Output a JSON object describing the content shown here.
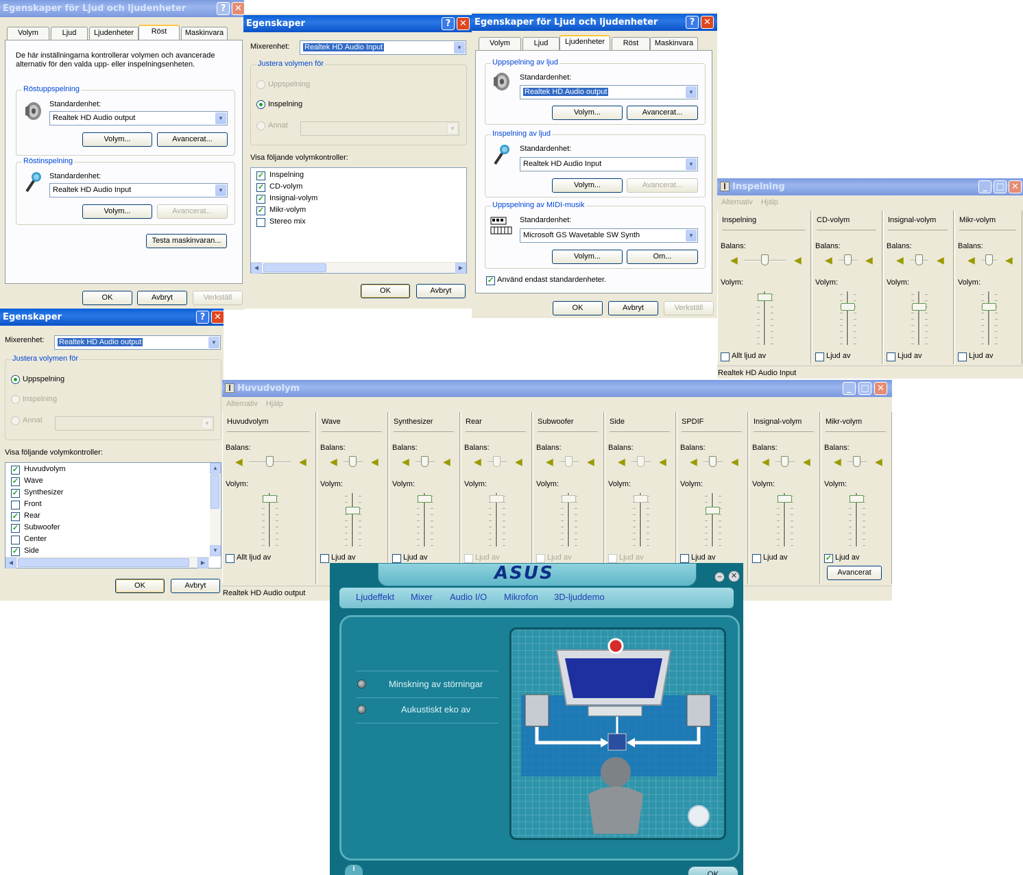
{
  "win1": {
    "title": "Egenskaper för Ljud och ljudenheter",
    "tabs": [
      "Volym",
      "Ljud",
      "Ljudenheter",
      "Röst",
      "Maskinvara"
    ],
    "description": "De här inställningarna kontrollerar volymen och avancerade alternativ för den valda upp- eller inspelningsenheten.",
    "playback_group": "Röstuppspelning",
    "recording_group": "Röstinspelning",
    "default_device_label": "Standardenhet:",
    "playback_device": "Realtek HD Audio output",
    "recording_device": "Realtek HD Audio Input",
    "volume_btn": "Volym...",
    "advanced_btn": "Avancerat...",
    "test_btn": "Testa maskinvaran...",
    "ok": "OK",
    "cancel": "Avbryt",
    "apply": "Verkställ"
  },
  "win2": {
    "title": "Egenskaper",
    "mixer_label": "Mixerenhet:",
    "mixer_value": "Realtek HD Audio Input",
    "adjust_group": "Justera volymen för",
    "radio_playback": "Uppspelning",
    "radio_recording": "Inspelning",
    "radio_other": "Annat",
    "show_label": "Visa följande volymkontroller:",
    "controls": [
      {
        "label": "Inspelning",
        "checked": true
      },
      {
        "label": "CD-volym",
        "checked": true
      },
      {
        "label": "Insignal-volym",
        "checked": true
      },
      {
        "label": "Mikr-volym",
        "checked": true
      },
      {
        "label": "Stereo mix",
        "checked": false
      }
    ],
    "ok": "OK",
    "cancel": "Avbryt"
  },
  "win3": {
    "title": "Egenskaper för Ljud och ljudenheter",
    "tabs": [
      "Volym",
      "Ljud",
      "Ljudenheter",
      "Röst",
      "Maskinvara"
    ],
    "playback_group": "Uppspelning av ljud",
    "recording_group": "Inspelning av ljud",
    "midi_group": "Uppspelning av MIDI-musik",
    "default_device_label": "Standardenhet:",
    "playback_device": "Realtek HD Audio output",
    "recording_device": "Realtek HD Audio Input",
    "midi_device": "Microsoft GS Wavetable SW Synth",
    "volume_btn": "Volym...",
    "advanced_btn": "Avancerat...",
    "about_btn": "Om...",
    "only_default": "Använd endast standardenheter.",
    "ok": "OK",
    "cancel": "Avbryt",
    "apply": "Verkställ"
  },
  "win4": {
    "title": "Egenskaper",
    "mixer_label": "Mixerenhet:",
    "mixer_value": "Realtek HD Audio output",
    "adjust_group": "Justera volymen för",
    "radio_playback": "Uppspelning",
    "radio_recording": "Inspelning",
    "radio_other": "Annat",
    "show_label": "Visa följande volymkontroller:",
    "controls": [
      {
        "label": "Huvudvolym",
        "checked": true
      },
      {
        "label": "Wave",
        "checked": true
      },
      {
        "label": "Synthesizer",
        "checked": true
      },
      {
        "label": "Front",
        "checked": false
      },
      {
        "label": "Rear",
        "checked": true
      },
      {
        "label": "Subwoofer",
        "checked": true
      },
      {
        "label": "Center",
        "checked": false
      },
      {
        "label": "Side",
        "checked": true
      }
    ],
    "ok": "OK",
    "cancel": "Avbryt"
  },
  "rec_mixer": {
    "title": "Inspelning",
    "menu": [
      "Alternativ",
      "Hjälp"
    ],
    "balance_label": "Balans:",
    "volume_label": "Volym:",
    "status": "Realtek HD Audio Input",
    "channels": [
      {
        "name": "Inspelning",
        "mute_label": "Allt ljud av",
        "muted": false,
        "volume": 0.95,
        "balance": 0.5
      },
      {
        "name": "CD-volym",
        "mute_label": "Ljud av",
        "muted": false,
        "volume": 0.75,
        "balance": 0.5
      },
      {
        "name": "Insignal-volym",
        "mute_label": "Ljud av",
        "muted": false,
        "volume": 0.75,
        "balance": 0.5
      },
      {
        "name": "Mikr-volym",
        "mute_label": "Ljud av",
        "muted": false,
        "volume": 0.75,
        "balance": 0.5
      }
    ]
  },
  "main_mixer": {
    "title": "Huvudvolym",
    "menu": [
      "Alternativ",
      "Hjälp"
    ],
    "balance_label": "Balans:",
    "volume_label": "Volym:",
    "advanced_btn": "Avancerat",
    "status": "Realtek HD Audio output",
    "channels": [
      {
        "name": "Huvudvolym",
        "mute_label": "Allt ljud av",
        "muted": false,
        "enabled": true,
        "volume": 0.95
      },
      {
        "name": "Wave",
        "mute_label": "Ljud av",
        "muted": false,
        "enabled": true,
        "volume": 0.7
      },
      {
        "name": "Synthesizer",
        "mute_label": "Ljud av",
        "muted": false,
        "enabled": true,
        "volume": 0.95
      },
      {
        "name": "Rear",
        "mute_label": "Ljud av",
        "muted": false,
        "enabled": false,
        "volume": 0.95
      },
      {
        "name": "Subwoofer",
        "mute_label": "Ljud av",
        "muted": false,
        "enabled": false,
        "volume": 0.95
      },
      {
        "name": "Side",
        "mute_label": "Ljud av",
        "muted": false,
        "enabled": false,
        "volume": 0.95
      },
      {
        "name": "SPDIF",
        "mute_label": "Ljud av",
        "muted": false,
        "enabled": true,
        "volume": 0.7
      },
      {
        "name": "Insignal-volym",
        "mute_label": "Ljud av",
        "muted": false,
        "enabled": true,
        "volume": 0.95
      },
      {
        "name": "Mikr-volym",
        "mute_label": "Ljud av",
        "muted": true,
        "enabled": true,
        "volume": 0.95
      }
    ]
  },
  "asus": {
    "logo": "ASUS",
    "tabs": [
      "Ljudeffekt",
      "Mixer",
      "Audio I/O",
      "Mikrofon",
      "3D-ljuddemo"
    ],
    "options": [
      "Minskning av störningar",
      "Aukustiskt eko av"
    ],
    "ok": "OK"
  }
}
